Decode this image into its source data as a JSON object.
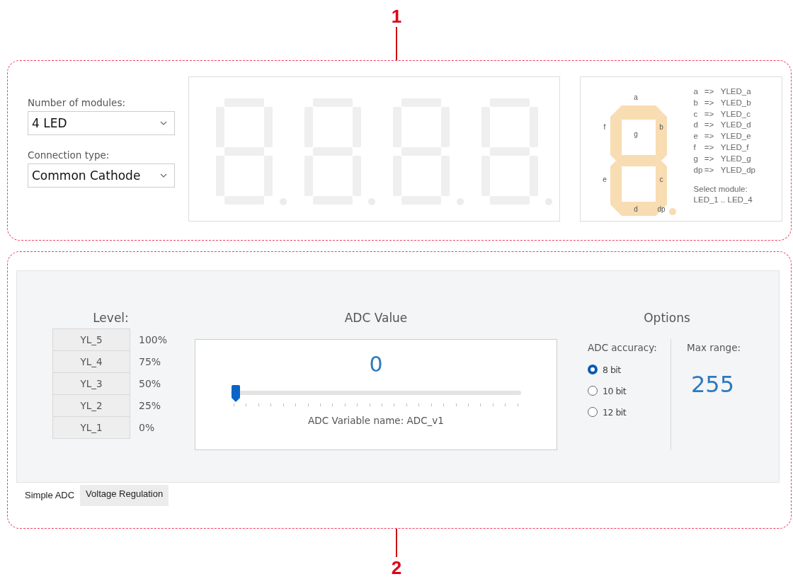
{
  "callouts": [
    "1",
    "2"
  ],
  "modules": {
    "label": "Number of modules:",
    "value": "4 LED"
  },
  "connection": {
    "label": "Connection type:",
    "value": "Common Cathode"
  },
  "segment_labels": [
    "a",
    "b",
    "c",
    "d",
    "e",
    "f",
    "g",
    "dp"
  ],
  "mapping": [
    {
      "segment": "a",
      "arrow": "=>",
      "target": "YLED_a"
    },
    {
      "segment": "b",
      "arrow": "=>",
      "target": "YLED_b"
    },
    {
      "segment": "c",
      "arrow": "=>",
      "target": "YLED_c"
    },
    {
      "segment": "d",
      "arrow": "=>",
      "target": "YLED_d"
    },
    {
      "segment": "e",
      "arrow": "=>",
      "target": "YLED_e"
    },
    {
      "segment": "f",
      "arrow": "=>",
      "target": "YLED_f"
    },
    {
      "segment": "g",
      "arrow": "=>",
      "target": "YLED_g"
    },
    {
      "segment": "dp",
      "arrow": "=>",
      "target": "YLED_dp"
    }
  ],
  "select_note": [
    "Select module:",
    "LED_1 .. LED_4"
  ],
  "level": {
    "title": "Level:",
    "rows": [
      {
        "name": "YL_5",
        "percent": "100%"
      },
      {
        "name": "YL_4",
        "percent": "75%"
      },
      {
        "name": "YL_3",
        "percent": "50%"
      },
      {
        "name": "YL_2",
        "percent": "25%"
      },
      {
        "name": "YL_1",
        "percent": "0%"
      }
    ]
  },
  "adc": {
    "title": "ADC Value",
    "value": "0",
    "slider": {
      "level": 0
    },
    "variable": "ADC Variable name: ADC_v1"
  },
  "options": {
    "title": "Options",
    "accuracy_label": "ADC accuracy:",
    "accuracy": [
      {
        "label": "8 bit",
        "selected": true
      },
      {
        "label": "10 bit",
        "selected": false
      },
      {
        "label": "12 bit",
        "selected": false
      }
    ],
    "max_label": "Max range:",
    "max_value": "255"
  },
  "tabs": [
    {
      "label": "Simple ADC",
      "selected": true
    },
    {
      "label": "Voltage Regulation",
      "selected": false
    }
  ]
}
